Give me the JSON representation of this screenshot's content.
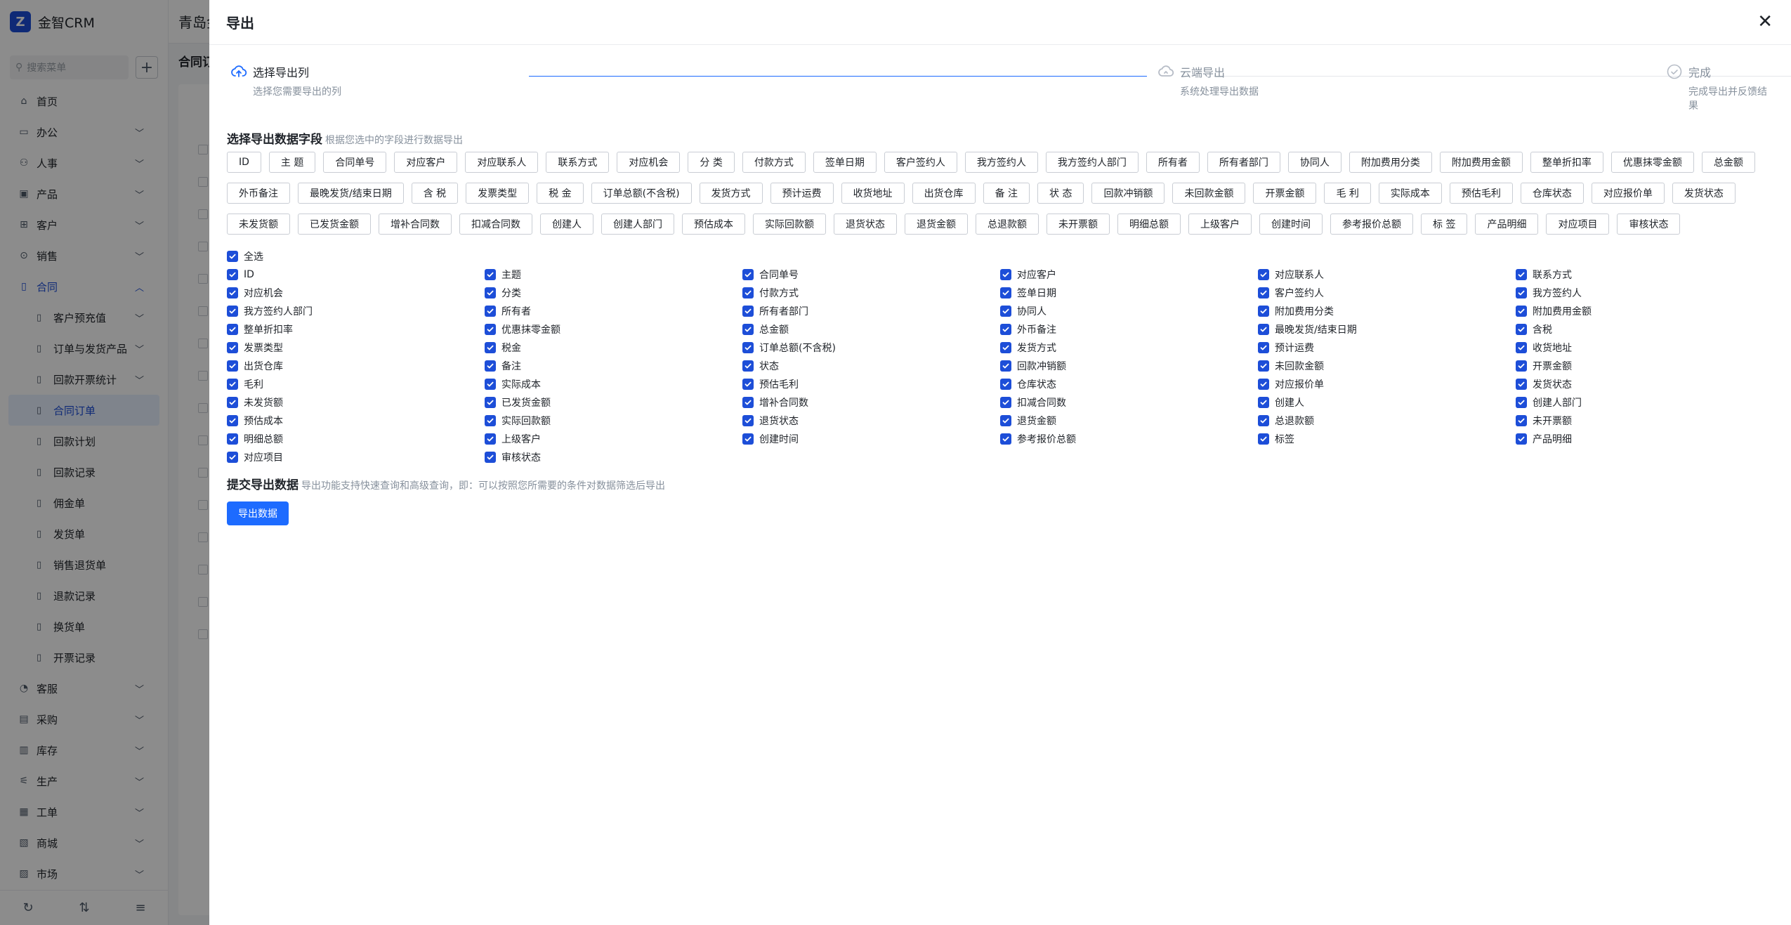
{
  "app": {
    "brand": "金智CRM",
    "top_title": "青岛金",
    "page_tab": "合同订",
    "search_placeholder": "搜索菜单"
  },
  "sidebar": {
    "menu": [
      {
        "label": "首页",
        "icon": "home-icon",
        "chevron": false
      },
      {
        "label": "办公",
        "icon": "office-icon",
        "chevron": true
      },
      {
        "label": "人事",
        "icon": "people-icon",
        "chevron": true
      },
      {
        "label": "产品",
        "icon": "product-icon",
        "chevron": true
      },
      {
        "label": "客户",
        "icon": "customer-icon",
        "chevron": true
      },
      {
        "label": "销售",
        "icon": "sales-icon",
        "chevron": true
      },
      {
        "label": "合同",
        "icon": "contract-icon",
        "chevron": true,
        "open": true
      }
    ],
    "submenu": [
      {
        "label": "客户预充值",
        "chevron": true
      },
      {
        "label": "订单与发货产品",
        "chevron": true
      },
      {
        "label": "回款开票统计",
        "chevron": true
      },
      {
        "label": "合同订单",
        "chevron": false,
        "active": true
      },
      {
        "label": "回款计划",
        "chevron": false
      },
      {
        "label": "回款记录",
        "chevron": false
      },
      {
        "label": "佣金单",
        "chevron": false
      },
      {
        "label": "发货单",
        "chevron": false
      },
      {
        "label": "销售退货单",
        "chevron": false
      },
      {
        "label": "退款记录",
        "chevron": false
      },
      {
        "label": "换货单",
        "chevron": false
      },
      {
        "label": "开票记录",
        "chevron": false
      }
    ],
    "menu_after": [
      {
        "label": "客服",
        "icon": "service-icon",
        "chevron": true
      },
      {
        "label": "采购",
        "icon": "purchase-icon",
        "chevron": true
      },
      {
        "label": "库存",
        "icon": "stock-icon",
        "chevron": true
      },
      {
        "label": "生产",
        "icon": "production-icon",
        "chevron": true
      },
      {
        "label": "工单",
        "icon": "ticket-icon",
        "chevron": true
      },
      {
        "label": "商城",
        "icon": "mall-icon",
        "chevron": true
      },
      {
        "label": "市场",
        "icon": "market-icon",
        "chevron": true
      }
    ]
  },
  "drawer": {
    "title": "导出",
    "steps": [
      {
        "title": "选择导出列",
        "desc": "选择您需要导出的列",
        "state": "active",
        "icon": "upload-cloud-icon"
      },
      {
        "title": "云端导出",
        "desc": "系统处理导出数据",
        "state": "inactive",
        "icon": "cloud-icon"
      },
      {
        "title": "完成",
        "desc": "完成导出并反馈结果",
        "state": "inactive",
        "icon": "check-circle-icon"
      }
    ],
    "select_section": {
      "title": "选择导出数据字段",
      "hint": "根据您选中的字段进行数据导出"
    },
    "chips": [
      "ID",
      "主 题",
      "合同单号",
      "对应客户",
      "对应联系人",
      "联系方式",
      "对应机会",
      "分 类",
      "付款方式",
      "签单日期",
      "客户签约人",
      "我方签约人",
      "我方签约人部门",
      "所有者",
      "所有者部门",
      "协同人",
      "附加费用分类",
      "附加费用金额",
      "整单折扣率",
      "优惠抹零金额",
      "总金额",
      "外币备注",
      "最晚发货/结束日期",
      "含 税",
      "发票类型",
      "税 金",
      "订单总额(不含税)",
      "发货方式",
      "预计运费",
      "收货地址",
      "出货仓库",
      "备 注",
      "状 态",
      "回款冲销额",
      "未回款金额",
      "开票金额",
      "毛 利",
      "实际成本",
      "预估毛利",
      "仓库状态",
      "对应报价单",
      "发货状态",
      "未发货额",
      "已发货金额",
      "增补合同数",
      "扣减合同数",
      "创建人",
      "创建人部门",
      "预估成本",
      "实际回款额",
      "退货状态",
      "退货金额",
      "总退款额",
      "未开票额",
      "明细总额",
      "上级客户",
      "创建时间",
      "参考报价总额",
      "标 签",
      "产品明细",
      "对应项目",
      "审核状态"
    ],
    "check_all_label": "全选",
    "checks": [
      "ID",
      "主题",
      "合同单号",
      "对应客户",
      "对应联系人",
      "联系方式",
      "对应机会",
      "分类",
      "付款方式",
      "签单日期",
      "客户签约人",
      "我方签约人",
      "我方签约人部门",
      "所有者",
      "所有者部门",
      "协同人",
      "附加费用分类",
      "附加费用金额",
      "整单折扣率",
      "优惠抹零金额",
      "总金额",
      "外币备注",
      "最晚发货/结束日期",
      "含税",
      "发票类型",
      "税金",
      "订单总额(不含税)",
      "发货方式",
      "预计运费",
      "收货地址",
      "出货仓库",
      "备注",
      "状态",
      "回款冲销额",
      "未回款金额",
      "开票金额",
      "毛利",
      "实际成本",
      "预估毛利",
      "仓库状态",
      "对应报价单",
      "发货状态",
      "未发货额",
      "已发货金额",
      "增补合同数",
      "扣减合同数",
      "创建人",
      "创建人部门",
      "预估成本",
      "实际回款额",
      "退货状态",
      "退货金额",
      "总退款额",
      "未开票额",
      "明细总额",
      "上级客户",
      "创建时间",
      "参考报价总额",
      "标签",
      "产品明细",
      "对应项目",
      "审核状态"
    ],
    "submit_section": {
      "title": "提交导出数据",
      "hint": "导出功能支持快速查询和高级查询，即：可以按照您所需要的条件对数据筛选后导出"
    },
    "export_button": "导出数据",
    "colors": {
      "accent": "#1d6bff",
      "checkbox": "#1d4ed8",
      "step_line": "#1d6bff"
    }
  }
}
